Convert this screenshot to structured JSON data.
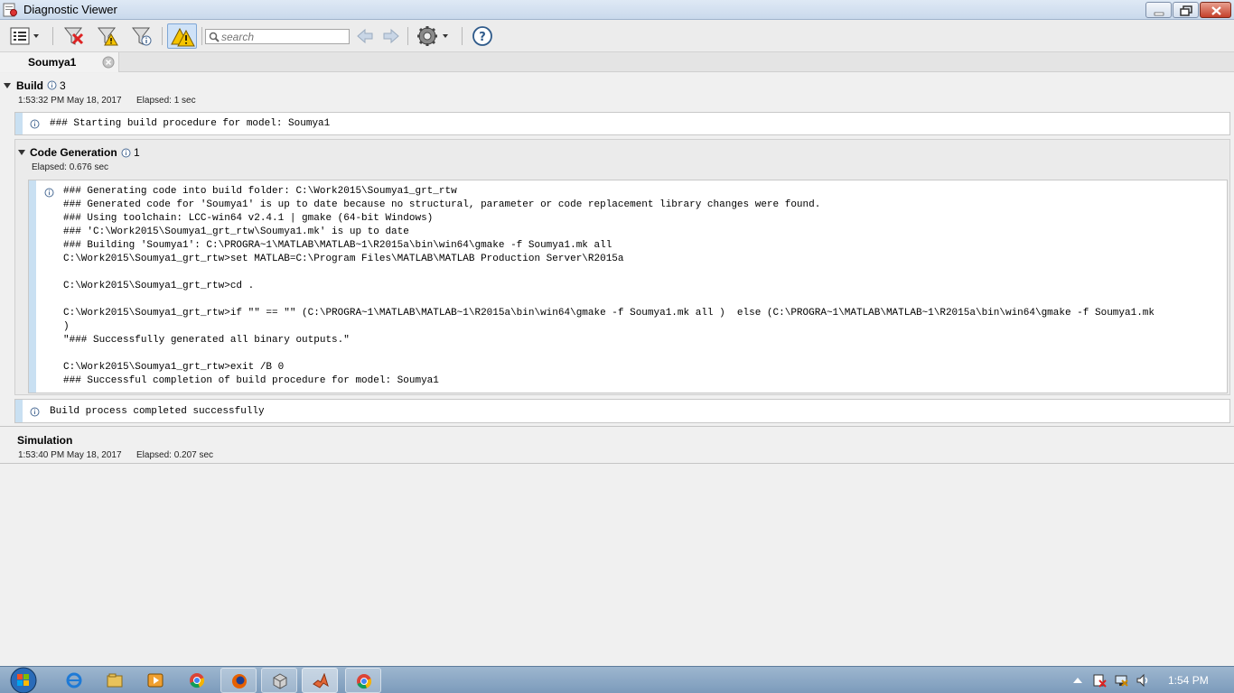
{
  "window": {
    "title": "Diagnostic Viewer"
  },
  "toolbar": {
    "search_placeholder": "search",
    "icons": [
      "view-list-icon",
      "clear-all-icon",
      "filter-warning-icon",
      "filter-icon",
      "warning-toggle-icon",
      "back-arrow-icon",
      "forward-arrow-icon",
      "settings-icon",
      "help-icon"
    ]
  },
  "tab": {
    "label": "Soumya1"
  },
  "build": {
    "title": "Build",
    "count": "3",
    "timestamp": "1:53:32 PM May 18, 2017",
    "elapsed": "Elapsed: 1 sec",
    "start_message": "### Starting build procedure for model: Soumya1",
    "complete_message": "Build process completed successfully"
  },
  "codegen": {
    "title": "Code Generation",
    "count": "1",
    "elapsed": "Elapsed: 0.676 sec",
    "lines": [
      "### Generating code into build folder: C:\\Work2015\\Soumya1_grt_rtw",
      "### Generated code for 'Soumya1' is up to date because no structural, parameter or code replacement library changes were found.",
      "### Using toolchain: LCC-win64 v2.4.1 | gmake (64-bit Windows)",
      "### 'C:\\Work2015\\Soumya1_grt_rtw\\Soumya1.mk' is up to date",
      "### Building 'Soumya1': C:\\PROGRA~1\\MATLAB\\MATLAB~1\\R2015a\\bin\\win64\\gmake -f Soumya1.mk all",
      "C:\\Work2015\\Soumya1_grt_rtw>set MATLAB=C:\\Program Files\\MATLAB\\MATLAB Production Server\\R2015a",
      "",
      "C:\\Work2015\\Soumya1_grt_rtw>cd .",
      "",
      "C:\\Work2015\\Soumya1_grt_rtw>if \"\" == \"\" (C:\\PROGRA~1\\MATLAB\\MATLAB~1\\R2015a\\bin\\win64\\gmake -f Soumya1.mk all )  else (C:\\PROGRA~1\\MATLAB\\MATLAB~1\\R2015a\\bin\\win64\\gmake -f Soumya1.mk",
      ")",
      "\"### Successfully generated all binary outputs.\"",
      "",
      "C:\\Work2015\\Soumya1_grt_rtw>exit /B 0",
      "### Successful completion of build procedure for model: Soumya1"
    ]
  },
  "simulation": {
    "title": "Simulation",
    "timestamp": "1:53:40 PM May 18, 2017",
    "elapsed": "Elapsed: 0.207 sec"
  },
  "taskbar": {
    "clock": "1:54 PM",
    "apps": [
      "windows-start-icon",
      "internet-explorer-icon",
      "file-explorer-icon",
      "media-player-icon",
      "chrome-icon",
      "firefox-icon",
      "cube-app-icon",
      "matlab-icon",
      "chrome-icon"
    ]
  }
}
